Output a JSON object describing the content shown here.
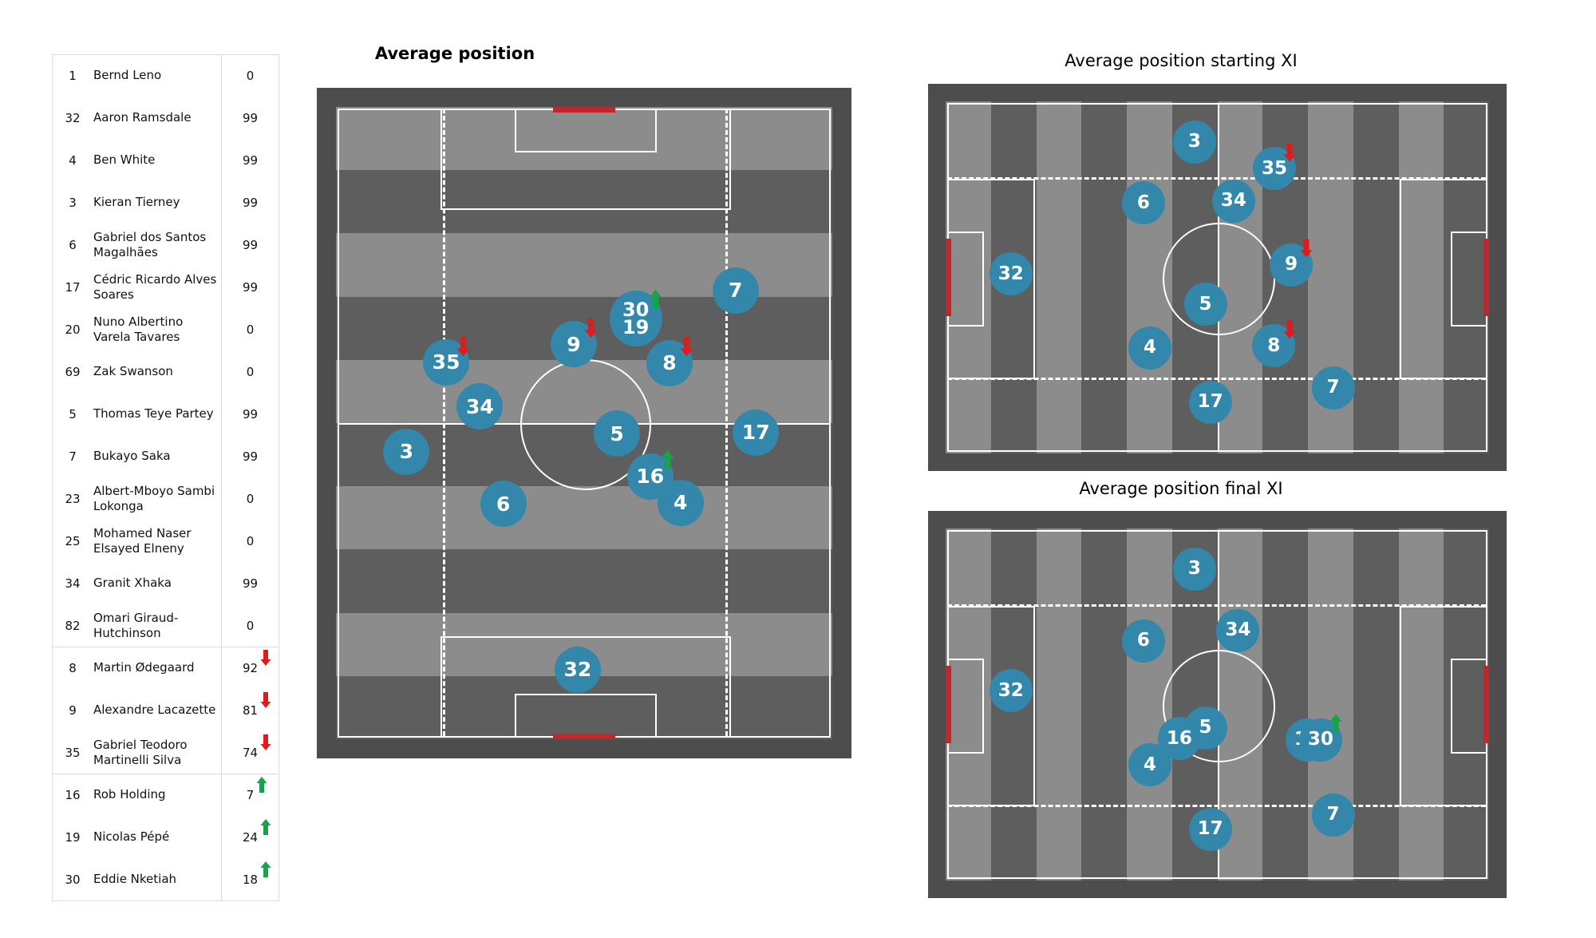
{
  "titles": {
    "main": "Average position",
    "starting": "Average position starting XI",
    "final": "Average position final XI"
  },
  "colors": {
    "marker": "#3287ab",
    "marker_text": "#ffffff",
    "sub_off_arrow": "#e01b1b",
    "sub_on_arrow": "#18a34a",
    "goal": "#c0272d",
    "pitch_border": "#4d4d4d",
    "pitch_light": "#8c8c8c",
    "pitch_dark": "#5e5e5e",
    "line": "#ffffff"
  },
  "table": {
    "rows": [
      {
        "number": "1",
        "name": "Bernd Leno",
        "minutes": "0",
        "arrow": "none"
      },
      {
        "number": "32",
        "name": "Aaron Ramsdale",
        "minutes": "99",
        "arrow": "none"
      },
      {
        "number": "4",
        "name": "Ben White",
        "minutes": "99",
        "arrow": "none"
      },
      {
        "number": "3",
        "name": "Kieran Tierney",
        "minutes": "99",
        "arrow": "none"
      },
      {
        "number": "6",
        "name": "Gabriel dos Santos Magalhães",
        "minutes": "99",
        "arrow": "none"
      },
      {
        "number": "17",
        "name": "Cédric Ricardo Alves Soares",
        "minutes": "99",
        "arrow": "none"
      },
      {
        "number": "20",
        "name": "Nuno Albertino Varela Tavares",
        "minutes": "0",
        "arrow": "none"
      },
      {
        "number": "69",
        "name": "Zak Swanson",
        "minutes": "0",
        "arrow": "none"
      },
      {
        "number": "5",
        "name": "Thomas Teye Partey",
        "minutes": "99",
        "arrow": "none"
      },
      {
        "number": "7",
        "name": "Bukayo Saka",
        "minutes": "99",
        "arrow": "none"
      },
      {
        "number": "23",
        "name": "Albert-Mboyo Sambi Lokonga",
        "minutes": "0",
        "arrow": "none"
      },
      {
        "number": "25",
        "name": "Mohamed Naser Elsayed Elneny",
        "minutes": "0",
        "arrow": "none"
      },
      {
        "number": "34",
        "name": "Granit Xhaka",
        "minutes": "99",
        "arrow": "none"
      },
      {
        "number": "82",
        "name": "Omari Giraud-Hutchinson",
        "minutes": "0",
        "arrow": "none"
      },
      {
        "number": "8",
        "name": "Martin Ødegaard",
        "minutes": "92",
        "arrow": "down"
      },
      {
        "number": "9",
        "name": "Alexandre Lacazette",
        "minutes": "81",
        "arrow": "down"
      },
      {
        "number": "35",
        "name": "Gabriel Teodoro Martinelli Silva",
        "minutes": "74",
        "arrow": "down"
      },
      {
        "number": "16",
        "name": "Rob Holding",
        "minutes": "7",
        "arrow": "up"
      },
      {
        "number": "19",
        "name": "Nicolas Pépé",
        "minutes": "24",
        "arrow": "up"
      },
      {
        "number": "30",
        "name": "Eddie Nketiah",
        "minutes": "18",
        "arrow": "up"
      }
    ],
    "group_dividers_after": [
      13,
      16
    ]
  },
  "chart_data": {
    "type": "scatter",
    "title": "Average position",
    "pitches": [
      {
        "id": "main",
        "title": "Average position",
        "orientation": "vertical",
        "players": [
          {
            "number": "7",
            "x": 0.805,
            "y": 0.29,
            "arrow": "none"
          },
          {
            "number": "30",
            "x": 0.604,
            "y": 0.334,
            "arrow": "up",
            "stack": "top"
          },
          {
            "number": "19",
            "x": 0.604,
            "y": 0.334,
            "arrow": "none",
            "stack": "bottom"
          },
          {
            "number": "9",
            "x": 0.479,
            "y": 0.375,
            "arrow": "down"
          },
          {
            "number": "8",
            "x": 0.672,
            "y": 0.405,
            "arrow": "down"
          },
          {
            "number": "35",
            "x": 0.222,
            "y": 0.404,
            "arrow": "down"
          },
          {
            "number": "34",
            "x": 0.29,
            "y": 0.474,
            "arrow": "none"
          },
          {
            "number": "5",
            "x": 0.566,
            "y": 0.517,
            "arrow": "none"
          },
          {
            "number": "17",
            "x": 0.846,
            "y": 0.515,
            "arrow": "none"
          },
          {
            "number": "3",
            "x": 0.142,
            "y": 0.545,
            "arrow": "none"
          },
          {
            "number": "16",
            "x": 0.633,
            "y": 0.584,
            "arrow": "up"
          },
          {
            "number": "4",
            "x": 0.694,
            "y": 0.626,
            "arrow": "none"
          },
          {
            "number": "6",
            "x": 0.337,
            "y": 0.628,
            "arrow": "none"
          },
          {
            "number": "32",
            "x": 0.487,
            "y": 0.89,
            "arrow": "none"
          }
        ]
      },
      {
        "id": "starting",
        "title": "Average position starting XI",
        "orientation": "horizontal",
        "players": [
          {
            "number": "3",
            "x": 0.458,
            "y": 0.115,
            "arrow": "none"
          },
          {
            "number": "35",
            "x": 0.605,
            "y": 0.191,
            "arrow": "down"
          },
          {
            "number": "34",
            "x": 0.53,
            "y": 0.283,
            "arrow": "none"
          },
          {
            "number": "6",
            "x": 0.364,
            "y": 0.288,
            "arrow": "none"
          },
          {
            "number": "9",
            "x": 0.636,
            "y": 0.464,
            "arrow": "down"
          },
          {
            "number": "5",
            "x": 0.478,
            "y": 0.576,
            "arrow": "none"
          },
          {
            "number": "32",
            "x": 0.12,
            "y": 0.49,
            "arrow": "none"
          },
          {
            "number": "8",
            "x": 0.604,
            "y": 0.695,
            "arrow": "down"
          },
          {
            "number": "4",
            "x": 0.376,
            "y": 0.7,
            "arrow": "none"
          },
          {
            "number": "7",
            "x": 0.713,
            "y": 0.813,
            "arrow": "none"
          },
          {
            "number": "17",
            "x": 0.487,
            "y": 0.854,
            "arrow": "none"
          }
        ]
      },
      {
        "id": "final",
        "title": "Average position final XI",
        "orientation": "horizontal",
        "players": [
          {
            "number": "3",
            "x": 0.458,
            "y": 0.115,
            "arrow": "none"
          },
          {
            "number": "34",
            "x": 0.538,
            "y": 0.29,
            "arrow": "none"
          },
          {
            "number": "6",
            "x": 0.364,
            "y": 0.319,
            "arrow": "none"
          },
          {
            "number": "32",
            "x": 0.12,
            "y": 0.461,
            "arrow": "none"
          },
          {
            "number": "5",
            "x": 0.478,
            "y": 0.566,
            "arrow": "none"
          },
          {
            "number": "16",
            "x": 0.43,
            "y": 0.597,
            "arrow": "none"
          },
          {
            "number": "19",
            "x": 0.665,
            "y": 0.6,
            "arrow": "none",
            "stack": "pair-left"
          },
          {
            "number": "30",
            "x": 0.69,
            "y": 0.6,
            "arrow": "up",
            "stack": "pair-right"
          },
          {
            "number": "4",
            "x": 0.376,
            "y": 0.672,
            "arrow": "none"
          },
          {
            "number": "17",
            "x": 0.487,
            "y": 0.854,
            "arrow": "none"
          },
          {
            "number": "7",
            "x": 0.713,
            "y": 0.813,
            "arrow": "none"
          }
        ]
      }
    ]
  }
}
